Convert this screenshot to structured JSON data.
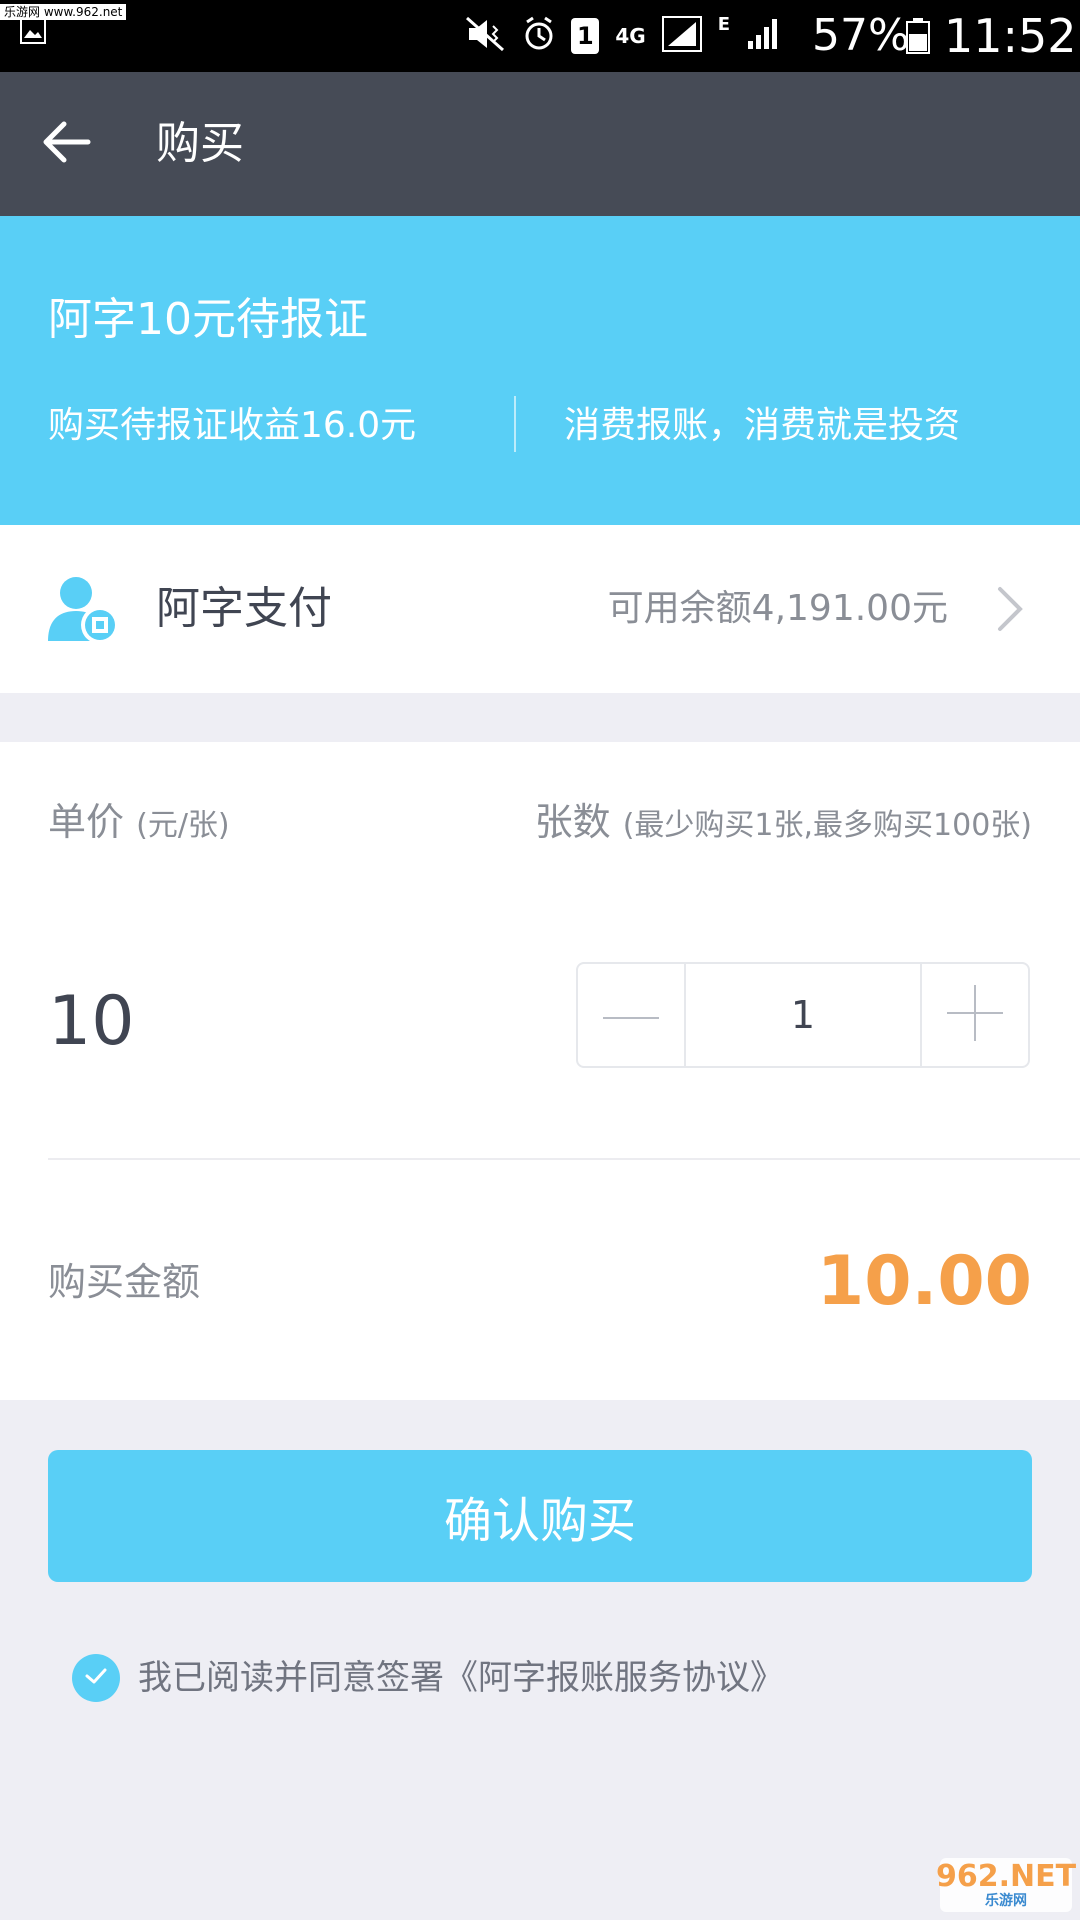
{
  "status_bar": {
    "watermark": "乐游网 www.962.net",
    "network": "4G",
    "sim_slot": "1",
    "edge_label": "E",
    "battery": "57%",
    "time": "11:52"
  },
  "header": {
    "title": "购买",
    "back_icon": "arrow-left-icon"
  },
  "banner": {
    "title": "阿字10元待报证",
    "left_text": "购买待报证收益16.0元",
    "right_text": "消费报账，消费就是投资"
  },
  "payment": {
    "method": "阿字支付",
    "balance": "可用余额4,191.00元",
    "icon": "user-pay-icon"
  },
  "purchase": {
    "unit_label": "单价",
    "unit_hint": "(元/张)",
    "count_label": "张数",
    "count_hint": "(最少购买1张,最多购买100张)",
    "unit_price": "10",
    "quantity": "1",
    "total_label": "购买金额",
    "total_amount": "10.00"
  },
  "actions": {
    "confirm": "确认购买"
  },
  "agreement": {
    "checked": true,
    "text": "我已阅读并同意签署《阿字报账服务协议》"
  },
  "watermark": {
    "top": "962.NET",
    "bottom": "乐游网"
  },
  "colors": {
    "accent": "#59cff6",
    "header_bg": "#464b56",
    "amount": "#f5a04a"
  }
}
